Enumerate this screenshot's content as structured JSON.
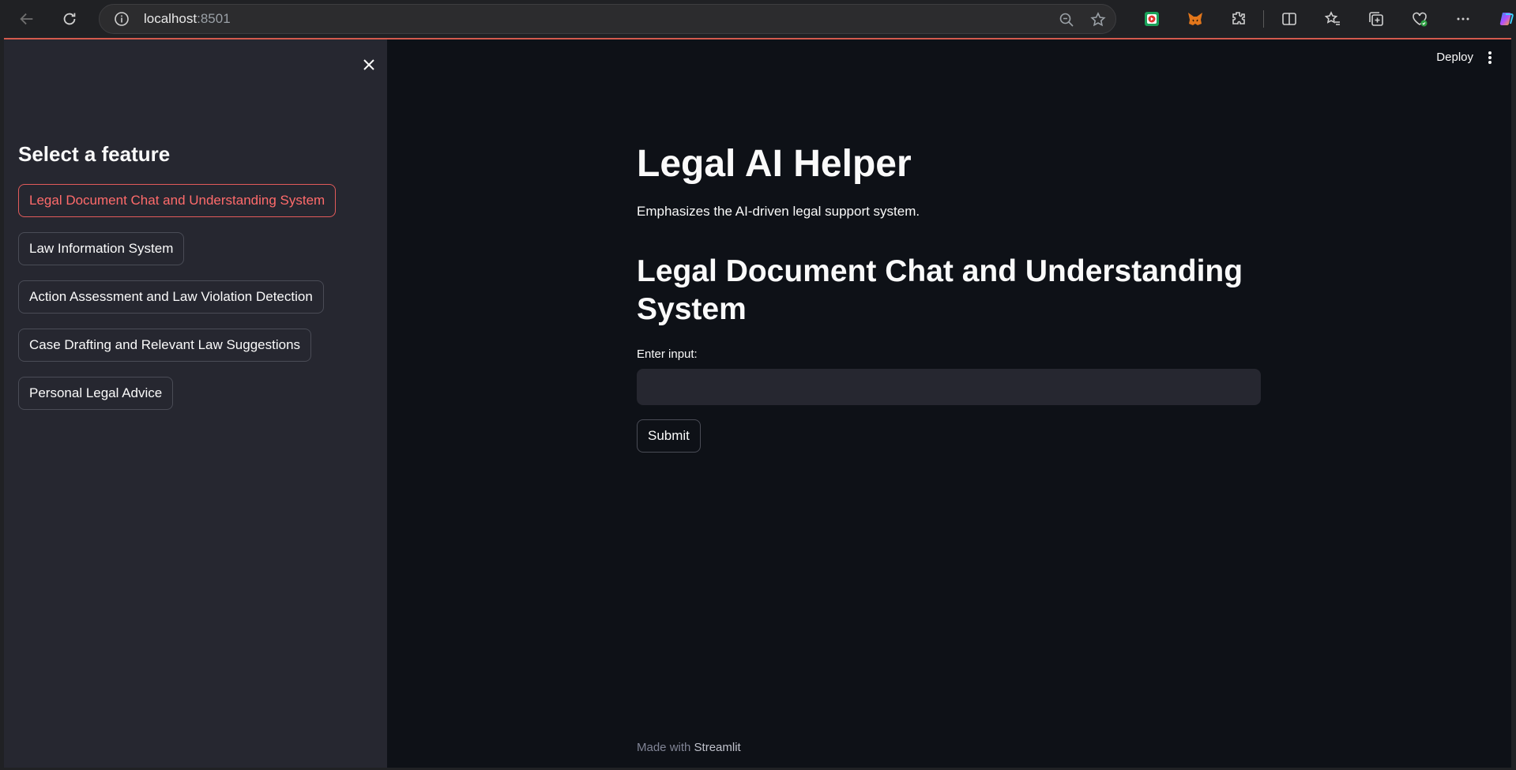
{
  "browser": {
    "url_host": "localhost",
    "url_port": ":8501"
  },
  "sidebar": {
    "title": "Select a feature",
    "features": [
      {
        "label": "Legal Document Chat and Understanding System",
        "active": true
      },
      {
        "label": "Law Information System",
        "active": false
      },
      {
        "label": "Action Assessment and Law Violation Detection",
        "active": false
      },
      {
        "label": "Case Drafting and Relevant Law Suggestions",
        "active": false
      },
      {
        "label": "Personal Legal Advice",
        "active": false
      }
    ]
  },
  "header": {
    "deploy_label": "Deploy"
  },
  "main": {
    "title": "Legal AI Helper",
    "subtitle": "Emphasizes the AI-driven legal support system.",
    "section_title": "Legal Document Chat and Understanding System",
    "input_label": "Enter input:",
    "input_value": "",
    "submit_label": "Submit"
  },
  "footer": {
    "prefix": "Made with ",
    "brand": "Streamlit"
  },
  "colors": {
    "app_bg": "#0e1117",
    "sidebar_bg": "#262730",
    "accent": "#ff4b4b"
  }
}
